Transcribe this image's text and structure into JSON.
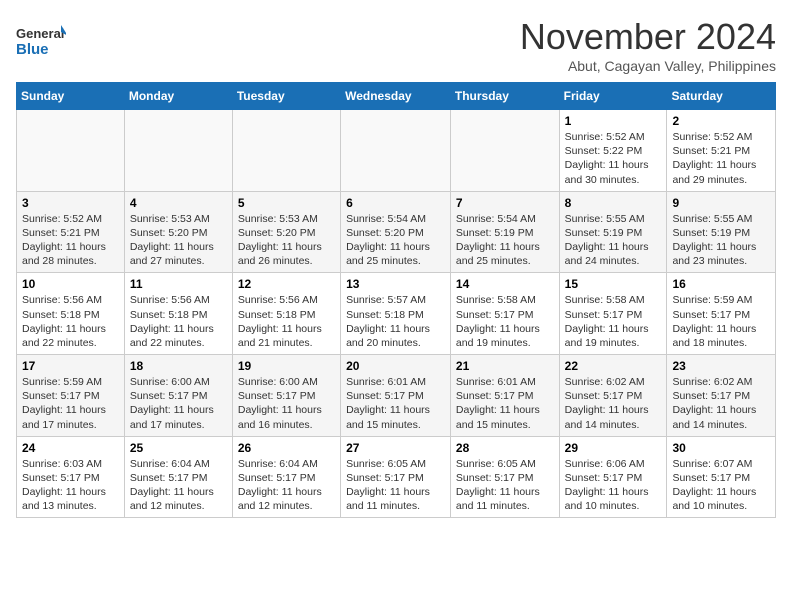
{
  "header": {
    "logo_line1": "General",
    "logo_line2": "Blue",
    "month": "November 2024",
    "location": "Abut, Cagayan Valley, Philippines"
  },
  "days_of_week": [
    "Sunday",
    "Monday",
    "Tuesday",
    "Wednesday",
    "Thursday",
    "Friday",
    "Saturday"
  ],
  "weeks": [
    [
      {
        "day": "",
        "info": ""
      },
      {
        "day": "",
        "info": ""
      },
      {
        "day": "",
        "info": ""
      },
      {
        "day": "",
        "info": ""
      },
      {
        "day": "",
        "info": ""
      },
      {
        "day": "1",
        "info": "Sunrise: 5:52 AM\nSunset: 5:22 PM\nDaylight: 11 hours and 30 minutes."
      },
      {
        "day": "2",
        "info": "Sunrise: 5:52 AM\nSunset: 5:21 PM\nDaylight: 11 hours and 29 minutes."
      }
    ],
    [
      {
        "day": "3",
        "info": "Sunrise: 5:52 AM\nSunset: 5:21 PM\nDaylight: 11 hours and 28 minutes."
      },
      {
        "day": "4",
        "info": "Sunrise: 5:53 AM\nSunset: 5:20 PM\nDaylight: 11 hours and 27 minutes."
      },
      {
        "day": "5",
        "info": "Sunrise: 5:53 AM\nSunset: 5:20 PM\nDaylight: 11 hours and 26 minutes."
      },
      {
        "day": "6",
        "info": "Sunrise: 5:54 AM\nSunset: 5:20 PM\nDaylight: 11 hours and 25 minutes."
      },
      {
        "day": "7",
        "info": "Sunrise: 5:54 AM\nSunset: 5:19 PM\nDaylight: 11 hours and 25 minutes."
      },
      {
        "day": "8",
        "info": "Sunrise: 5:55 AM\nSunset: 5:19 PM\nDaylight: 11 hours and 24 minutes."
      },
      {
        "day": "9",
        "info": "Sunrise: 5:55 AM\nSunset: 5:19 PM\nDaylight: 11 hours and 23 minutes."
      }
    ],
    [
      {
        "day": "10",
        "info": "Sunrise: 5:56 AM\nSunset: 5:18 PM\nDaylight: 11 hours and 22 minutes."
      },
      {
        "day": "11",
        "info": "Sunrise: 5:56 AM\nSunset: 5:18 PM\nDaylight: 11 hours and 22 minutes."
      },
      {
        "day": "12",
        "info": "Sunrise: 5:56 AM\nSunset: 5:18 PM\nDaylight: 11 hours and 21 minutes."
      },
      {
        "day": "13",
        "info": "Sunrise: 5:57 AM\nSunset: 5:18 PM\nDaylight: 11 hours and 20 minutes."
      },
      {
        "day": "14",
        "info": "Sunrise: 5:58 AM\nSunset: 5:17 PM\nDaylight: 11 hours and 19 minutes."
      },
      {
        "day": "15",
        "info": "Sunrise: 5:58 AM\nSunset: 5:17 PM\nDaylight: 11 hours and 19 minutes."
      },
      {
        "day": "16",
        "info": "Sunrise: 5:59 AM\nSunset: 5:17 PM\nDaylight: 11 hours and 18 minutes."
      }
    ],
    [
      {
        "day": "17",
        "info": "Sunrise: 5:59 AM\nSunset: 5:17 PM\nDaylight: 11 hours and 17 minutes."
      },
      {
        "day": "18",
        "info": "Sunrise: 6:00 AM\nSunset: 5:17 PM\nDaylight: 11 hours and 17 minutes."
      },
      {
        "day": "19",
        "info": "Sunrise: 6:00 AM\nSunset: 5:17 PM\nDaylight: 11 hours and 16 minutes."
      },
      {
        "day": "20",
        "info": "Sunrise: 6:01 AM\nSunset: 5:17 PM\nDaylight: 11 hours and 15 minutes."
      },
      {
        "day": "21",
        "info": "Sunrise: 6:01 AM\nSunset: 5:17 PM\nDaylight: 11 hours and 15 minutes."
      },
      {
        "day": "22",
        "info": "Sunrise: 6:02 AM\nSunset: 5:17 PM\nDaylight: 11 hours and 14 minutes."
      },
      {
        "day": "23",
        "info": "Sunrise: 6:02 AM\nSunset: 5:17 PM\nDaylight: 11 hours and 14 minutes."
      }
    ],
    [
      {
        "day": "24",
        "info": "Sunrise: 6:03 AM\nSunset: 5:17 PM\nDaylight: 11 hours and 13 minutes."
      },
      {
        "day": "25",
        "info": "Sunrise: 6:04 AM\nSunset: 5:17 PM\nDaylight: 11 hours and 12 minutes."
      },
      {
        "day": "26",
        "info": "Sunrise: 6:04 AM\nSunset: 5:17 PM\nDaylight: 11 hours and 12 minutes."
      },
      {
        "day": "27",
        "info": "Sunrise: 6:05 AM\nSunset: 5:17 PM\nDaylight: 11 hours and 11 minutes."
      },
      {
        "day": "28",
        "info": "Sunrise: 6:05 AM\nSunset: 5:17 PM\nDaylight: 11 hours and 11 minutes."
      },
      {
        "day": "29",
        "info": "Sunrise: 6:06 AM\nSunset: 5:17 PM\nDaylight: 11 hours and 10 minutes."
      },
      {
        "day": "30",
        "info": "Sunrise: 6:07 AM\nSunset: 5:17 PM\nDaylight: 11 hours and 10 minutes."
      }
    ]
  ]
}
